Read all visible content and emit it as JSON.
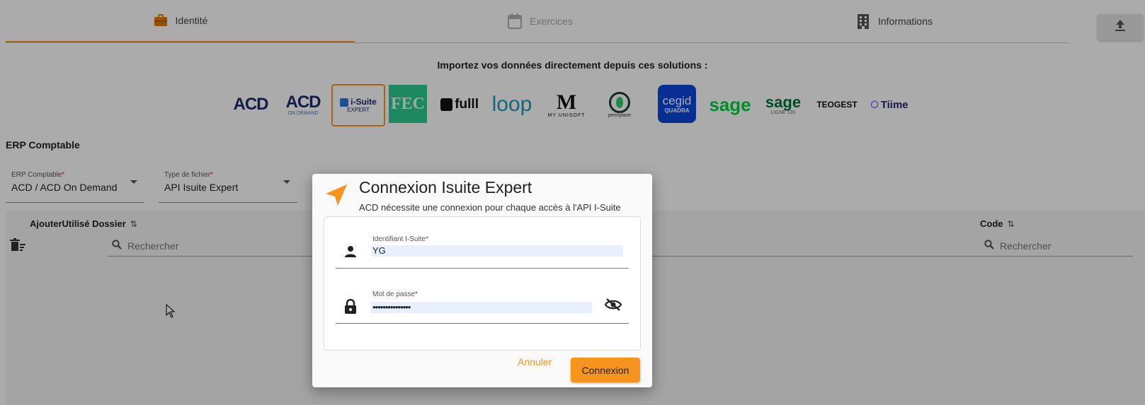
{
  "tabs": [
    {
      "label": "Identité",
      "icon": "briefcase-icon",
      "active": true
    },
    {
      "label": "Exercices",
      "icon": "calendar-icon",
      "active": false
    },
    {
      "label": "Informations",
      "icon": "building-icon",
      "active": false
    }
  ],
  "upload_icon": "upload-icon",
  "import_title": "Importez vos données directement depuis ces solutions :",
  "logos": {
    "acd": "ACD",
    "acd_od_top": "ACD",
    "acd_od_bottom": "ON DEMAND",
    "isuite_top": "i-Suite",
    "isuite_bottom": "EXPERT",
    "fec": "FEC",
    "fulll": "fulll",
    "loop": "loop",
    "unisoft_top": "M",
    "unisoft_bottom": "MY UNISOFT",
    "pennylane": "pennylane",
    "cegid_top": "cegid",
    "cegid_bottom": "QUADRA",
    "sage": "sage",
    "sage100_top": "sage",
    "sage100_bottom": "LIGNE 100",
    "teogest": "TEOGEST",
    "tiime": "Tiime"
  },
  "section_title": "ERP Comptable",
  "erp_select": {
    "label": "ERP Comptable",
    "required": "*",
    "value": "ACD / ACD On Demand"
  },
  "type_select": {
    "label": "Type de fichier",
    "required": "*",
    "value": "API Isuite Expert"
  },
  "table": {
    "col_left": "AjouterUtilisé Dossier",
    "col_code": "Code",
    "sort_symbol": "⇅",
    "search_left_placeholder": "Rechercher",
    "search_code_placeholder": "Rechercher"
  },
  "dialog": {
    "title": "Connexion Isuite Expert",
    "subtitle": "ACD nécessite une connexion pour chaque accès à l'API I-Suite",
    "login_label": "Identifiant I-Suite*",
    "login_value": "YG",
    "password_label": "Mot de passe*",
    "password_value": "•••••••••••••••",
    "cancel_label": "Annuler",
    "submit_label": "Connexion"
  },
  "colors": {
    "accent": "#f7941d",
    "cegid_bg": "#0b47d8",
    "fec_bg": "#2ecc8f",
    "sage_green": "#00d639",
    "loop_teal": "#1b9bb5"
  }
}
